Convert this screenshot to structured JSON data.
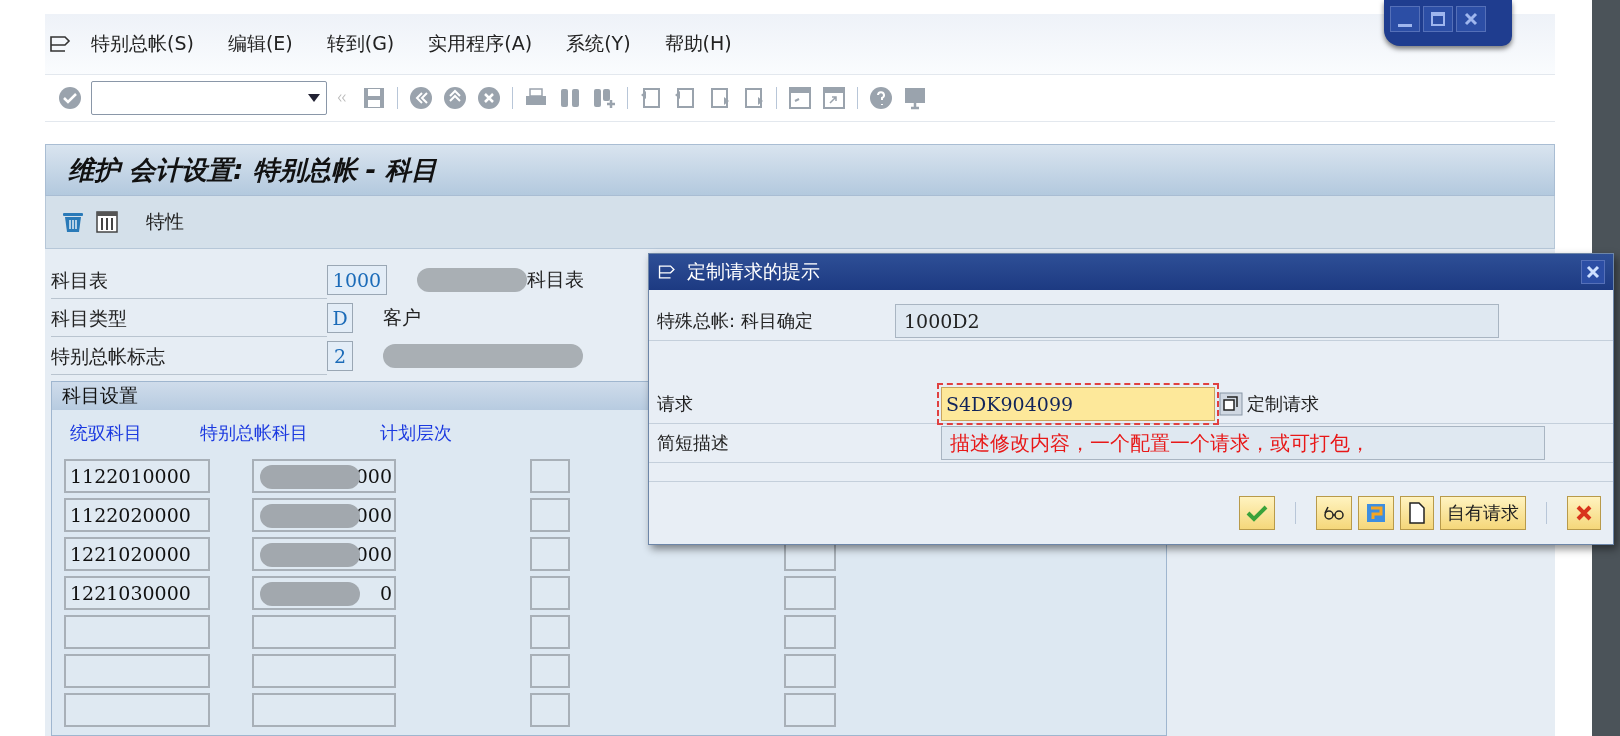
{
  "menu": [
    {
      "label": "特别总帐(S)"
    },
    {
      "label": "编辑(E)"
    },
    {
      "label": "转到(G)"
    },
    {
      "label": "实用程序(A)"
    },
    {
      "label": "系统(Y)"
    },
    {
      "label": "帮助(H)"
    }
  ],
  "title": "维护 会计设置: 特别总帐 - 科目",
  "app_toolbar": {
    "button": "特性"
  },
  "header_fields": [
    {
      "label": "科目表",
      "value": "1000",
      "description": "科目表",
      "redacted": true
    },
    {
      "label": "科目类型",
      "value": "D",
      "description": "客户",
      "redacted": false
    },
    {
      "label": "特别总帐标志",
      "value": "2",
      "redacted": true
    }
  ],
  "group": {
    "title": "科目设置",
    "columns": [
      "统驭科目",
      "特别总帐科目",
      "计划层次"
    ],
    "rows": [
      {
        "kind": "filled",
        "recon": "1122010000",
        "special": "000"
      },
      {
        "kind": "filled",
        "recon": "1122020000",
        "special": "000"
      },
      {
        "kind": "filled",
        "recon": "1221020000",
        "special": "000"
      },
      {
        "kind": "filled",
        "recon": "1221030000",
        "special": "0"
      },
      {
        "kind": "empty"
      },
      {
        "kind": "empty"
      },
      {
        "kind": "empty"
      }
    ]
  },
  "dialog": {
    "title": "定制请求的提示",
    "object": {
      "label": "特殊总帐: 科目确定",
      "value": "1000D2"
    },
    "request": {
      "label": "请求",
      "value": "S4DK904099",
      "link": "定制请求"
    },
    "short_text": {
      "label": "简短描述",
      "value": "描述修改内容，一个配置一个请求，或可打包，"
    },
    "own_requests_button": "自有请求"
  }
}
